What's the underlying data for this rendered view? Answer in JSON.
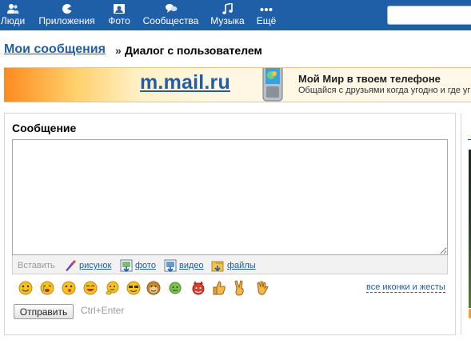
{
  "topnav": {
    "items": [
      {
        "label": "Люди",
        "icon": "people-icon"
      },
      {
        "label": "Приложения",
        "icon": "apps-icon"
      },
      {
        "label": "Фото",
        "icon": "photo-icon"
      },
      {
        "label": "Сообщества",
        "icon": "communities-icon"
      },
      {
        "label": "Музыка",
        "icon": "music-note-icon"
      },
      {
        "label": "Ещё",
        "icon": "more-dots-icon"
      }
    ],
    "search": {
      "placeholder": ""
    },
    "color": "#1f5fa8"
  },
  "breadcrumb": {
    "main": "Мои сообщения",
    "separator": "»",
    "current": "Диалог с пользователем"
  },
  "banner": {
    "url": "m.mail.ru",
    "title": "Мой Мир в твоем телефоне",
    "subtitle": "Общайся с друзьями когда угодно и где уг",
    "icon": "mobile-phone-icon"
  },
  "message": {
    "heading": "Сообщение",
    "text_value": "",
    "attach": {
      "insert_label": "Вставить",
      "items": [
        {
          "label": "рисунок",
          "icon": "paint-icon"
        },
        {
          "label": "фото",
          "icon": "photo-upload-icon"
        },
        {
          "label": "видео",
          "icon": "video-upload-icon"
        },
        {
          "label": "файлы",
          "icon": "file-upload-icon"
        }
      ]
    },
    "emoticons": [
      "smiley-icon",
      "crying-icon",
      "kiss-icon",
      "laughing-icon",
      "thinking-icon",
      "cool-icon",
      "angry-icon",
      "devil-icon",
      "thumbs-up-icon",
      "victory-icon",
      "hand-wave-icon"
    ],
    "all_icons_link": "все иконки и жесты",
    "send_label": "Отправить",
    "send_hint": "Ctrl+Enter"
  }
}
